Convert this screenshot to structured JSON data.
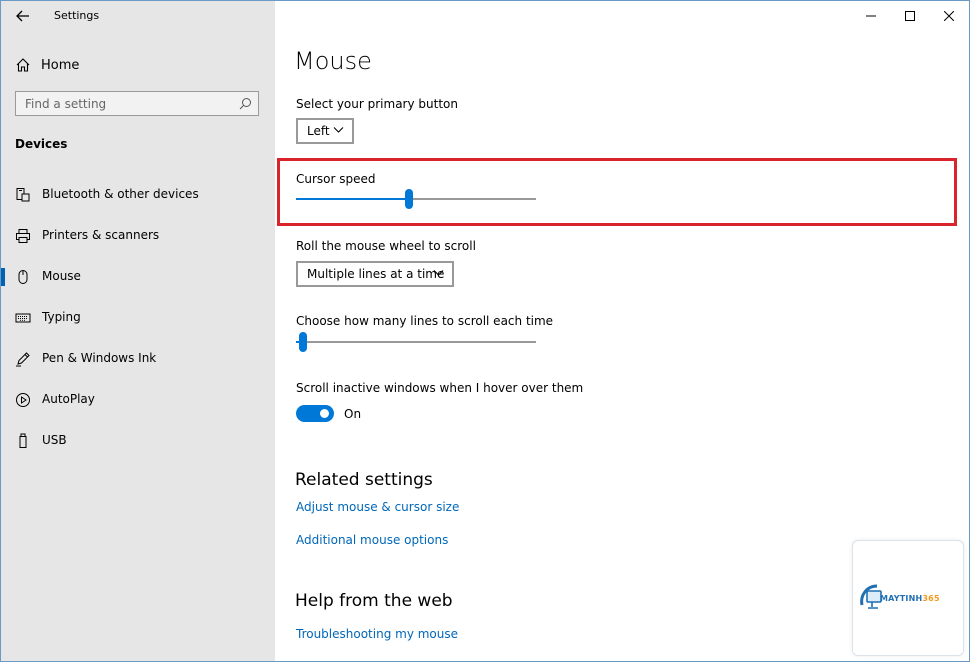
{
  "window": {
    "title": "Settings"
  },
  "sidebar": {
    "home_label": "Home",
    "search_placeholder": "Find a setting",
    "section_title": "Devices",
    "items": [
      {
        "label": "Bluetooth & other devices",
        "icon": "bluetooth-device-icon",
        "active": false
      },
      {
        "label": "Printers & scanners",
        "icon": "printer-icon",
        "active": false
      },
      {
        "label": "Mouse",
        "icon": "mouse-icon",
        "active": true
      },
      {
        "label": "Typing",
        "icon": "keyboard-icon",
        "active": false
      },
      {
        "label": "Pen & Windows Ink",
        "icon": "pen-icon",
        "active": false
      },
      {
        "label": "AutoPlay",
        "icon": "autoplay-icon",
        "active": false
      },
      {
        "label": "USB",
        "icon": "usb-icon",
        "active": false
      }
    ]
  },
  "main": {
    "title": "Mouse",
    "primary_button": {
      "label": "Select your primary button",
      "value": "Left"
    },
    "cursor_speed": {
      "label": "Cursor speed",
      "value_fraction": 0.47
    },
    "scroll_wheel": {
      "label": "Roll the mouse wheel to scroll",
      "value": "Multiple lines at a time"
    },
    "lines_to_scroll": {
      "label": "Choose how many lines to scroll each time",
      "value_fraction": 0.03
    },
    "inactive_scroll": {
      "label": "Scroll inactive windows when I hover over them",
      "state": "On"
    },
    "related": {
      "title": "Related settings",
      "links": [
        "Adjust mouse & cursor size",
        "Additional mouse options"
      ]
    },
    "help": {
      "title": "Help from the web",
      "links": [
        "Troubleshooting my mouse"
      ]
    }
  },
  "watermark": {
    "brand_main": "MAYTINH",
    "brand_accent": "365"
  },
  "colors": {
    "accent": "#0078d7",
    "link": "#0067b8",
    "highlight": "#d9242b",
    "sidebar_bg": "#e6e6e6"
  }
}
